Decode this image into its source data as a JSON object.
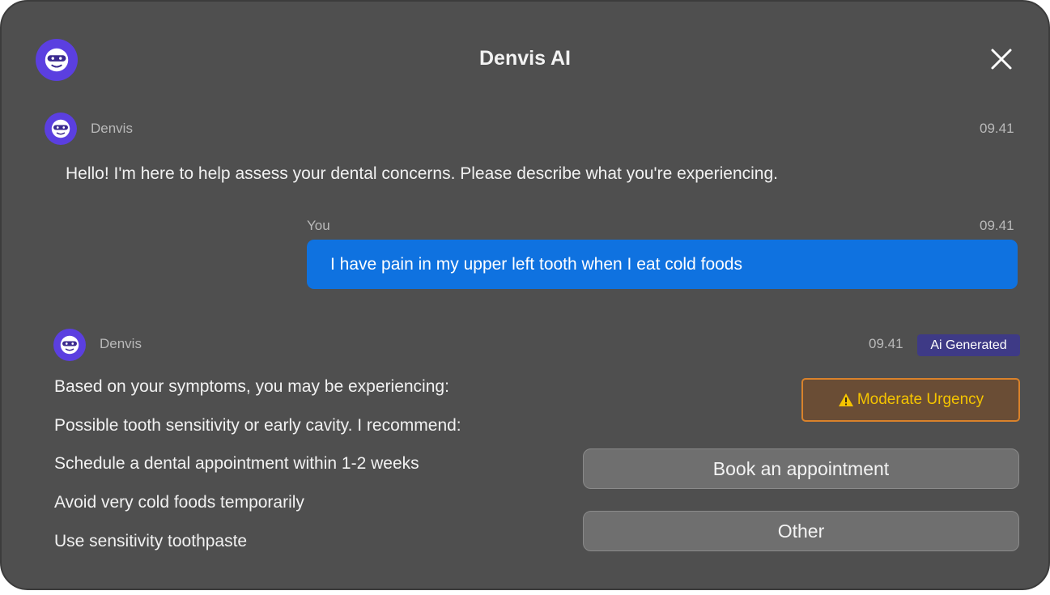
{
  "header": {
    "title": "Denvis AI",
    "close_icon": "close-icon",
    "logo_icon": "robot-avatar-icon"
  },
  "messages": [
    {
      "sender": "Denvis",
      "time": "09.41",
      "text": "Hello! I'm here to help assess your dental concerns. Please describe what you're experiencing."
    },
    {
      "sender": "You",
      "time": "09.41",
      "text": "I have pain in my upper left tooth when I eat cold foods"
    },
    {
      "sender": "Denvis",
      "time": "09.41",
      "badge": "Ai Generated",
      "lines": [
        "Based on your symptoms, you may be experiencing:",
        "Possible tooth sensitivity or early cavity. I recommend:",
        "Schedule a dental appointment within 1-2 weeks",
        "Avoid very cold foods temporarily",
        "Use sensitivity toothpaste"
      ],
      "urgency": {
        "label": "Moderate Urgency",
        "icon": "warning-icon"
      },
      "actions": [
        {
          "label": "Book an appointment"
        },
        {
          "label": "Other"
        }
      ]
    }
  ],
  "colors": {
    "panel_bg": "#4f4f4f",
    "user_bubble": "#0f72e0",
    "avatar": "#5b3fe0",
    "badge_bg": "#3e3a86",
    "urgency_border": "#d9822b",
    "urgency_text": "#f5c400"
  }
}
